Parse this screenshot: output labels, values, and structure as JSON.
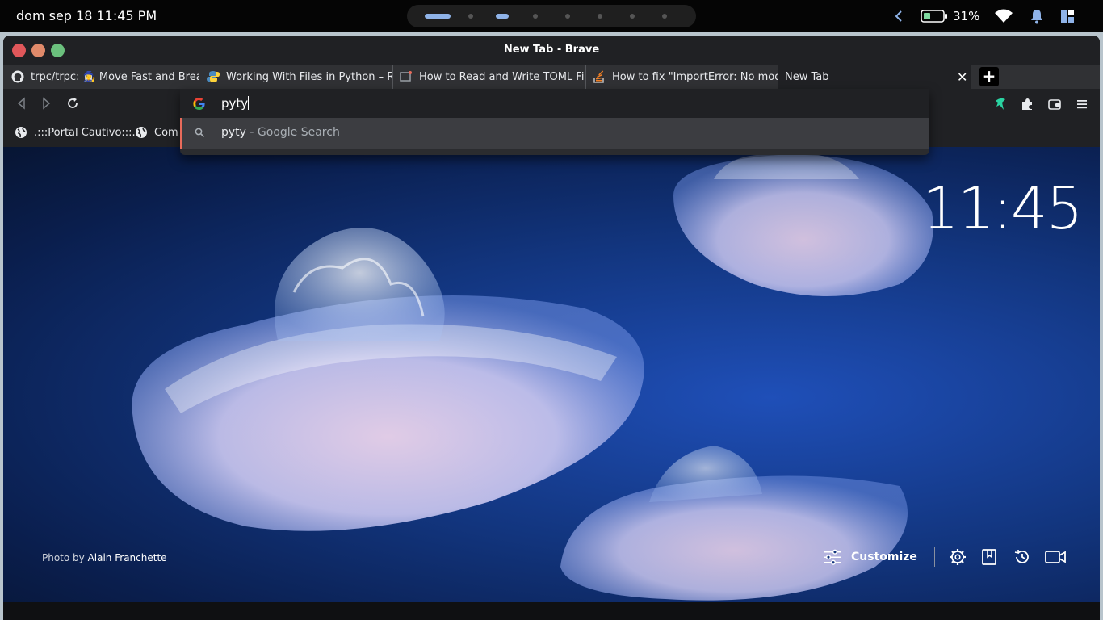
{
  "system_bar": {
    "datetime": "dom sep 18 11:45 PM",
    "battery_percent": "31%",
    "workspaces": {
      "count": 8,
      "active_index": 0,
      "occupied_index": 2
    },
    "icons": [
      "chevron-left-icon",
      "battery-icon",
      "wifi-icon",
      "bell-icon",
      "panel-icon"
    ]
  },
  "window": {
    "title": "New Tab - Brave",
    "traffic_colors": {
      "close": "#e0575a",
      "minimize": "#e08a6a",
      "maximize": "#6bc07d"
    }
  },
  "tabs": [
    {
      "label": "trpc/trpc: 🧙‍♀️ Move Fast and Break",
      "icon": "github-icon"
    },
    {
      "label": "Working With Files in Python – Re",
      "icon": "python-icon"
    },
    {
      "label": "How to Read and Write TOML File",
      "icon": "site-icon"
    },
    {
      "label": "How to fix \"ImportError: No modu",
      "icon": "stackoverflow-icon"
    },
    {
      "label": "New Tab",
      "icon": "",
      "active": true
    }
  ],
  "toolbar": {
    "back_icon": "back-icon",
    "forward_icon": "forward-icon",
    "reload_icon": "reload-icon",
    "right_icons": [
      "brave-rewards-icon",
      "extensions-icon",
      "wallet-icon",
      "menu-icon"
    ]
  },
  "bookmarks": [
    {
      "label": ".:::Portal Cautivo:::.",
      "icon": "globe-icon"
    },
    {
      "label": "Com",
      "icon": "globe-icon"
    }
  ],
  "omnibox": {
    "input_value": "pyty",
    "suggestion_query": "pyty",
    "suggestion_suffix": " - Google Search"
  },
  "ntp": {
    "clock": "11:45",
    "photo_credit_prefix": "Photo by ",
    "photo_credit_author": "Alain Franchette",
    "customize_label": "Customize",
    "bottom_icons": [
      "settings-icon",
      "bookmarks-icon",
      "history-icon",
      "video-call-icon"
    ]
  },
  "colors": {
    "accent_tab_indicator": "#e86b5b",
    "workspace_active": "#8fb3e8",
    "brave_rewards": "#2ad3a2"
  }
}
